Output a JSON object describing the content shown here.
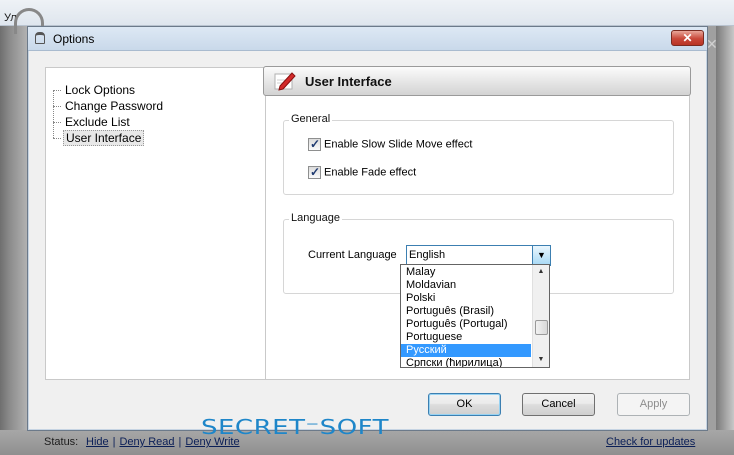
{
  "background": {
    "title_fragment": "Ул",
    "status": {
      "label": "Status:",
      "links": [
        "Hide",
        "Deny Read",
        "Deny Write"
      ],
      "separator": "|",
      "check_updates": "Check for updates"
    }
  },
  "dialog": {
    "title": "Options",
    "close_glyph": "✕",
    "tree": {
      "items": [
        {
          "label": "Lock Options"
        },
        {
          "label": "Change Password"
        },
        {
          "label": "Exclude List"
        },
        {
          "label": "User Interface",
          "selected": true
        }
      ]
    },
    "section_title": "User Interface",
    "general": {
      "legend": "General",
      "checkboxes": [
        {
          "label": "Enable Slow Slide Move effect",
          "checked": true
        },
        {
          "label": "Enable Fade effect",
          "checked": true
        }
      ]
    },
    "language": {
      "legend": "Language",
      "current_label": "Current Language",
      "selected_value": "English",
      "options_visible": [
        "Malay",
        "Moldavian",
        "Polski",
        "Português (Brasil)",
        "Português (Portugal)",
        "Portuguese",
        "Русский",
        "Српски (ћирилица)"
      ],
      "highlighted_option": "Русский"
    },
    "logo_text": "SECRET⁻SOFT",
    "buttons": {
      "ok": "OK",
      "cancel": "Cancel",
      "apply": "Apply"
    }
  },
  "colors": {
    "logo": "#1e86c9",
    "highlight": "#3399ff",
    "close_button": "#c9483a"
  }
}
